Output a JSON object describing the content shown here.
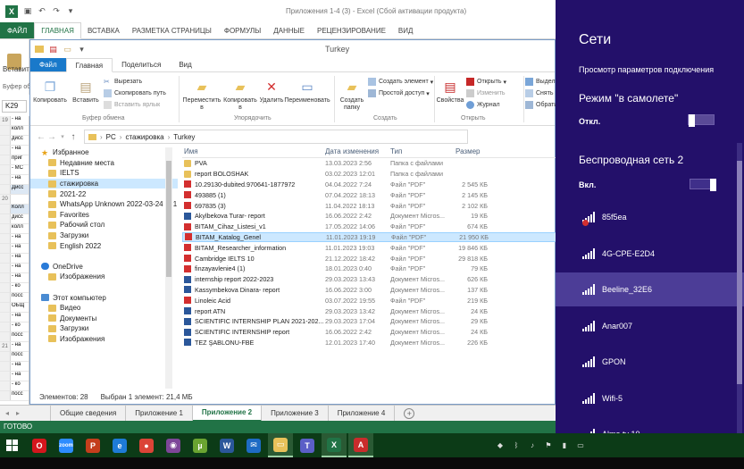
{
  "excel": {
    "title": "Приложения 1-4     (3)  -  Excel (Сбой активации продукта)",
    "tabs": [
      "ФАЙЛ",
      "ГЛАВНАЯ",
      "ВСТАВКА",
      "РАЗМЕТКА СТРАНИЦЫ",
      "ФОРМУЛЫ",
      "ДАННЫЕ",
      "РЕЦЕНЗИРОВАНИЕ",
      "ВИД"
    ],
    "paste_label": "Вставить",
    "clipboard_label": "Буфер об",
    "namebox": "K29",
    "rows": [
      {
        "n": "19",
        "t": "- на"
      },
      {
        "n": "",
        "t": "колл"
      },
      {
        "n": "",
        "t": "дисс"
      },
      {
        "n": "",
        "t": "- на"
      },
      {
        "n": "",
        "t": "приг"
      },
      {
        "n": "",
        "t": "- МС"
      },
      {
        "n": "",
        "t": "- на"
      },
      {
        "n": "",
        "t": "Дисс"
      },
      {
        "n": "20",
        "t": ""
      },
      {
        "n": "",
        "t": "Колл"
      },
      {
        "n": "",
        "t": "дисс"
      },
      {
        "n": "",
        "t": "колл"
      },
      {
        "n": "",
        "t": "- на"
      },
      {
        "n": "",
        "t": "- на"
      },
      {
        "n": "",
        "t": "- на"
      },
      {
        "n": "",
        "t": "- на"
      },
      {
        "n": "",
        "t": "- на"
      },
      {
        "n": "",
        "t": "- ко"
      },
      {
        "n": "",
        "t": "посс"
      },
      {
        "n": "",
        "t": "ОБЩ"
      },
      {
        "n": "",
        "t": "- на"
      },
      {
        "n": "",
        "t": "- ко"
      },
      {
        "n": "",
        "t": "посс"
      },
      {
        "n": "21",
        "t": "- на"
      },
      {
        "n": "",
        "t": "посс"
      },
      {
        "n": "",
        "t": "- на"
      },
      {
        "n": "",
        "t": "- на"
      },
      {
        "n": "",
        "t": "- ко"
      },
      {
        "n": "",
        "t": "посс"
      }
    ],
    "sheets": [
      "Общие сведения",
      "Приложение 1",
      "Приложение 2",
      "Приложение 3",
      "Приложение 4"
    ],
    "active_sheet": 2,
    "status": "ГОТОВО"
  },
  "explorer": {
    "title": "Turkey",
    "tabs": [
      "Файл",
      "Главная",
      "Поделиться",
      "Вид"
    ],
    "ribbon": {
      "copy": "Копировать",
      "paste": "Вставить",
      "cut": "Вырезать",
      "copy_path": "Скопировать путь",
      "paste_shortcut": "Вставить ярлык",
      "clipboard_group": "Буфер обмена",
      "move_to": "Переместить в",
      "copy_to": "Копировать в",
      "delete": "Удалить",
      "rename": "Переименовать",
      "organize_group": "Упорядочить",
      "new_folder": "Создать папку",
      "new_item": "Создать элемент",
      "easy_access": "Простой доступ",
      "create_group": "Создать",
      "properties": "Свойства",
      "open": "Открыть",
      "edit": "Изменить",
      "history": "Журнал",
      "open_group": "Открыть",
      "select_all": "Выделить",
      "select_none": "Снять выд",
      "invert": "Обратить"
    },
    "address": [
      "PC",
      "стажировка",
      "Turkey"
    ],
    "nav": [
      {
        "label": "Избранное",
        "icon": "star",
        "indent": 0
      },
      {
        "label": "Недавние места",
        "icon": "folder",
        "indent": 1
      },
      {
        "label": "IELTS",
        "icon": "folder",
        "indent": 1
      },
      {
        "label": "стажировка",
        "icon": "folder",
        "indent": 1,
        "selected": true
      },
      {
        "label": "2021-22",
        "icon": "folder",
        "indent": 1
      },
      {
        "label": "WhatsApp Unknown 2022-03-24 at 1",
        "icon": "folder",
        "indent": 1
      },
      {
        "label": "Favorites",
        "icon": "folder",
        "indent": 1
      },
      {
        "label": "Рабочий стол",
        "icon": "folder",
        "indent": 1
      },
      {
        "label": "Загрузки",
        "icon": "folder",
        "indent": 1
      },
      {
        "label": "English 2022",
        "icon": "folder",
        "indent": 1
      },
      {
        "label": "",
        "icon": "",
        "indent": 0
      },
      {
        "label": "OneDrive",
        "icon": "cloud",
        "indent": 0
      },
      {
        "label": "Изображения",
        "icon": "folder",
        "indent": 1
      },
      {
        "label": "",
        "icon": "",
        "indent": 0
      },
      {
        "label": "Этот компьютер",
        "icon": "pc",
        "indent": 0
      },
      {
        "label": "Видео",
        "icon": "folder",
        "indent": 1
      },
      {
        "label": "Документы",
        "icon": "folder",
        "indent": 1
      },
      {
        "label": "Загрузки",
        "icon": "folder",
        "indent": 1
      },
      {
        "label": "Изображения",
        "icon": "folder",
        "indent": 1
      }
    ],
    "columns": [
      "Имя",
      "Дата изменения",
      "Тип",
      "Размер"
    ],
    "files": [
      {
        "name": "PVA",
        "date": "13.03.2023 2:56",
        "type": "Папка с файлами",
        "size": "",
        "icon": "folder"
      },
      {
        "name": "report BOLOSHAK",
        "date": "03.02.2023 12:01",
        "type": "Папка с файлами",
        "size": "",
        "icon": "folder"
      },
      {
        "name": "10.29130-dubited.970641-1877972",
        "date": "04.04.2022 7:24",
        "type": "Файл \"PDF\"",
        "size": "2 545 КБ",
        "icon": "pdf"
      },
      {
        "name": "493885 (1)",
        "date": "07.04.2022 18:13",
        "type": "Файл \"PDF\"",
        "size": "2 145 КБ",
        "icon": "pdf"
      },
      {
        "name": "697835 (3)",
        "date": "11.04.2022 18:13",
        "type": "Файл \"PDF\"",
        "size": "2 102 КБ",
        "icon": "pdf"
      },
      {
        "name": "Akylbekova Turar- report",
        "date": "16.06.2022 2:42",
        "type": "Документ Micros...",
        "size": "19 КБ",
        "icon": "word"
      },
      {
        "name": "BITAM_Cihaz_Listesi_v1",
        "date": "17.05.2022 14:06",
        "type": "Файл \"PDF\"",
        "size": "674 КБ",
        "icon": "pdf"
      },
      {
        "name": "BITAM_Katalog_Genel",
        "date": "11.01.2023 19:19",
        "type": "Файл \"PDF\"",
        "size": "21 950 КБ",
        "icon": "pdf",
        "selected": true
      },
      {
        "name": "BITAM_Researcher_information",
        "date": "11.01.2023 19:03",
        "type": "Файл \"PDF\"",
        "size": "19 846 КБ",
        "icon": "pdf"
      },
      {
        "name": "Cambridge IELTS 10",
        "date": "21.12.2022 18:42",
        "type": "Файл \"PDF\"",
        "size": "29 818 КБ",
        "icon": "pdf"
      },
      {
        "name": "finzayavlenie4 (1)",
        "date": "18.01.2023 0:40",
        "type": "Файл \"PDF\"",
        "size": "79 КБ",
        "icon": "pdf"
      },
      {
        "name": "internship report 2022-2023",
        "date": "29.03.2023 13:43",
        "type": "Документ Micros...",
        "size": "626 КБ",
        "icon": "word"
      },
      {
        "name": "Kassymbekova Dinara- report",
        "date": "16.06.2022 3:00",
        "type": "Документ Micros...",
        "size": "137 КБ",
        "icon": "word"
      },
      {
        "name": "Linoleic Acid",
        "date": "03.07.2022 19:55",
        "type": "Файл \"PDF\"",
        "size": "219 КБ",
        "icon": "pdf"
      },
      {
        "name": "report ATN",
        "date": "29.03.2023 13:42",
        "type": "Документ Micros...",
        "size": "24 КБ",
        "icon": "word"
      },
      {
        "name": "SCIENTIFIC INTERNSHIP PLAN  2021-202...",
        "date": "29.03.2023 17:04",
        "type": "Документ Micros...",
        "size": "29 КБ",
        "icon": "word"
      },
      {
        "name": "SCIENTIFIC INTERNSHIP report",
        "date": "16.06.2022 2:42",
        "type": "Документ Micros...",
        "size": "24 КБ",
        "icon": "word"
      },
      {
        "name": "TEZ ŞABLONU-FBE",
        "date": "12.01.2023 17:40",
        "type": "Документ Micros...",
        "size": "226 КБ",
        "icon": "word"
      }
    ],
    "status_items": "Элементов: 28",
    "status_selected": "Выбран 1 элемент: 21,4 МБ"
  },
  "networks": {
    "title": "Сети",
    "view_params": "Просмотр параметров подключения",
    "airplane_title": "Режим \"в самолете\"",
    "airplane_state": "Откл.",
    "wifi_title": "Беспроводная сеть 2",
    "wifi_state": "Вкл.",
    "list": [
      {
        "name": "85f5ea",
        "warn": true
      },
      {
        "name": "4G-CPE-E2D4"
      },
      {
        "name": "Beeline_32E6",
        "selected": true
      },
      {
        "name": "Anar007"
      },
      {
        "name": "GPON"
      },
      {
        "name": "Wifi-5"
      },
      {
        "name": "Alma tv 10"
      }
    ]
  },
  "taskbar": {
    "apps": [
      {
        "id": "opera",
        "color": "#d4161d",
        "glyph": "O"
      },
      {
        "id": "zoom",
        "color": "#2d8cff",
        "glyph": "zoom"
      },
      {
        "id": "powerpoint",
        "color": "#c43e1c",
        "glyph": "P"
      },
      {
        "id": "ie",
        "color": "#1e7bd7",
        "glyph": "e"
      },
      {
        "id": "chrome",
        "color": "#db4437",
        "glyph": "●"
      },
      {
        "id": "tor",
        "color": "#7d4698",
        "glyph": "◉"
      },
      {
        "id": "utorrent",
        "color": "#6aa431",
        "glyph": "µ"
      },
      {
        "id": "word",
        "color": "#2b579a",
        "glyph": "W"
      },
      {
        "id": "mail",
        "color": "#1e6bc4",
        "glyph": "✉"
      },
      {
        "id": "explorer",
        "color": "#e8c15a",
        "glyph": "▭"
      },
      {
        "id": "teams",
        "color": "#5b5fc7",
        "glyph": "T"
      },
      {
        "id": "excel",
        "color": "#217346",
        "glyph": "X"
      },
      {
        "id": "acrobat",
        "color": "#c92c2c",
        "glyph": "A"
      }
    ],
    "active_apps": [
      "explorer",
      "excel",
      "acrobat"
    ],
    "tray": [
      "dropbox-icon",
      "bluetooth-icon",
      "volume-icon",
      "flag-icon",
      "network-icon",
      "battery-icon"
    ]
  }
}
